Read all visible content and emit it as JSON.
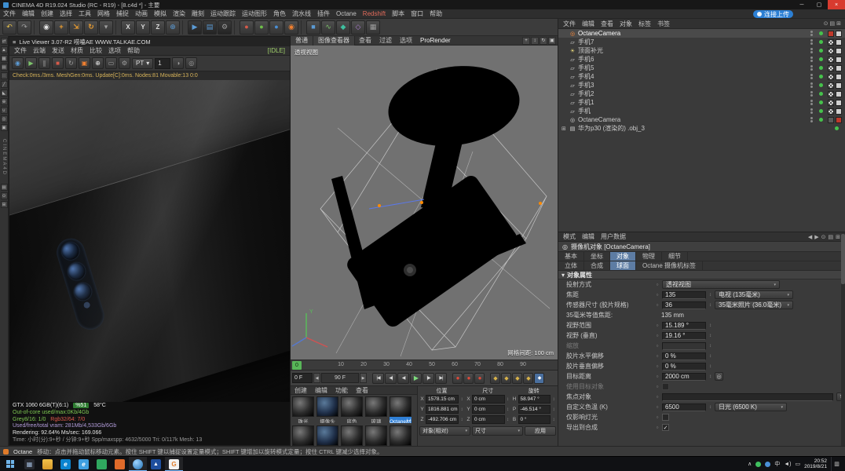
{
  "titlebar": {
    "title": "CINEMA 4D R19.024 Studio (RC - R19) - [8.c4d *] - 主要"
  },
  "window_controls": {
    "minimize": "─",
    "maximize": "▢",
    "close": "×"
  },
  "menubar": {
    "items": [
      "文件",
      "编辑",
      "创建",
      "选择",
      "工具",
      "网格",
      "捕捉",
      "动画",
      "模拟",
      "渲染",
      "雕刻",
      "运动跟踪",
      "运动图形",
      "角色",
      "流水线",
      "插件",
      "Octane",
      "Redshift",
      "脚本",
      "窗口",
      "帮助"
    ],
    "upload_badge": "连接上传"
  },
  "toolbar": {
    "axis_x": "X",
    "axis_y": "Y",
    "axis_z": "Z"
  },
  "left_palette": {
    "vertical_label": "CINEMA4D"
  },
  "icons": {
    "burger": "≡",
    "dot": "○",
    "undo": "↶",
    "redo": "↷",
    "live_selection": "◉",
    "move": "+",
    "scale": "⇲",
    "rotate": "↻",
    "last_tool": "▾",
    "coord": "⊕",
    "render_view": "▶",
    "render_pv": "▤",
    "render_settings": "⚙",
    "plugin_red": "●",
    "plugin_green": "●",
    "plugin_blue": "●",
    "octane": "◉",
    "cube": "■",
    "pen": "∿",
    "mograph": "◆",
    "deformer": "◇",
    "xpresso": "▦",
    "convert": "⇄",
    "model": "▲",
    "texture": "▦",
    "workplane": "▤",
    "points": "∷",
    "edges": "╱",
    "polygons": "◣",
    "axis": "⊕",
    "snap": "∪",
    "solo": "◎",
    "lockpal": "▣",
    "play": "▶",
    "pause": "∥",
    "stop": "■",
    "restart": "↻",
    "lock": "▣",
    "pick": "⊕",
    "region": "▭",
    "gear": "⚙",
    "clay": "◑",
    "dd": "▾",
    "spin": "↕",
    "check": "✓",
    "up": "↑",
    "target": "◎",
    "skip_start": "|◀",
    "prev_key": "◀|",
    "prev": "◀",
    "next": "▶",
    "next_key": "|▶",
    "skip_end": "▶|",
    "record": "●",
    "key": "◆",
    "cam_obj": "◎",
    "mesh_obj": "▱",
    "light_obj": "☀",
    "file_obj": "▤",
    "expander": "⊞",
    "nav_left": "◀",
    "nav_right": "▶",
    "lock2": "⊙",
    "grid2": "▤",
    "plus": "⊞",
    "chevron": "∧",
    "volume": "◄)",
    "battery": "▭",
    "notif": "▥",
    "taskview": "▦",
    "photos": "▲",
    "pan": "+",
    "zoomv": "↕",
    "rotv": "↻",
    "maxv": "▣",
    "viewcam": "◎"
  },
  "live_viewer": {
    "title": "Live Viewer 3.07-R2 唠嗑AE WWW.TALKAE.COM",
    "menus": [
      "文件",
      "云端",
      "发送",
      "材质",
      "比较",
      "选项",
      "帮助"
    ],
    "idle": "[IDLE]",
    "mode": "PT",
    "samples": "1",
    "status_line": "Check:0ms./3ms. MeshGen:0ms. Update[C]:0ms. Nodes:81 Movable:13  0:0",
    "gpu_name": "GTX 1060 6GB(T)(6:1)",
    "gpu_load": "%51",
    "gpu_temp": "58°C",
    "oc_line": "Out-of-core used/max:0Kb/4Gb",
    "grey_line": "Grey8/16: 1/0",
    "rgb_line": "Rgb32/64: 7/0",
    "vram_line": "Used/free/total vram: 281Mb/4,533Gb/6Gb",
    "render_line": "Rendering: 92.64%  Ms/sec: 169.066",
    "time_line": "Time: 小时(分):9+秒 / 分钟:9+秒  Spp/maxspp: 4632/5000  Tri: 0/117k  Mesh: 13"
  },
  "viewport": {
    "tabs": [
      "普通",
      "图像查看器"
    ],
    "menus": [
      "查看",
      "过滤",
      "选项",
      "ProRender"
    ],
    "view_label": "透视视图",
    "grid_label": "网格间距: 100 cm",
    "gizmo_y": "Y"
  },
  "timeline": {
    "playhead": "0",
    "ticks": [
      "10",
      "20",
      "30",
      "40",
      "50",
      "60",
      "70",
      "80",
      "90"
    ],
    "current": "0 F",
    "end": "90 F"
  },
  "materials": {
    "tabs": [
      "创建",
      "编辑",
      "功能",
      "查看"
    ],
    "labels": [
      "珠光",
      "摄像头",
      "底色",
      "玻璃",
      "Octane材质"
    ]
  },
  "coordinates": {
    "headers": [
      "位置",
      "尺寸",
      "旋转"
    ],
    "position": [
      {
        "axis": "X",
        "value": "1578.15 cm"
      },
      {
        "axis": "Y",
        "value": "1816.881 cm"
      },
      {
        "axis": "Z",
        "value": "-492.706 cm"
      }
    ],
    "size": [
      {
        "axis": "X",
        "value": "0 cm"
      },
      {
        "axis": "Y",
        "value": "0 cm"
      },
      {
        "axis": "Z",
        "value": "0 cm"
      }
    ],
    "rotation": [
      {
        "axis": "H",
        "value": "58.947 °"
      },
      {
        "axis": "P",
        "value": "-46.514 °"
      },
      {
        "axis": "B",
        "value": "0 °"
      }
    ],
    "mode_object": "对象(相对)",
    "mode_size": "尺寸",
    "apply": "应用"
  },
  "object_manager": {
    "menus": [
      "文件",
      "编辑",
      "查看",
      "对象",
      "标签",
      "书签"
    ],
    "items": [
      {
        "name": "OctaneCamera"
      },
      {
        "name": "手机7"
      },
      {
        "name": "顶面补光"
      },
      {
        "name": "手机6"
      },
      {
        "name": "手机5"
      },
      {
        "name": "手机4"
      },
      {
        "name": "手机3"
      },
      {
        "name": "手机2"
      },
      {
        "name": "手机1"
      },
      {
        "name": "手机"
      },
      {
        "name": "OctaneCamera"
      },
      {
        "name": "华为p30 (渲染的) .obj_3"
      }
    ]
  },
  "attributes": {
    "menus": [
      "模式",
      "编辑",
      "用户数据"
    ],
    "title": "摄像机对象 [OctaneCamera]",
    "tabs1": [
      "基本",
      "坐标",
      "对象",
      "物理",
      "细节"
    ],
    "tabs2": [
      "立体",
      "合成",
      "球面",
      "Octane 摄像机标签"
    ],
    "section": "对象属性",
    "projection_label": "投射方式",
    "projection_value": "透视视图",
    "focal_label": "焦距",
    "focal_value": "135",
    "focal_preset": "电视 (135毫米)",
    "sensor_label": "传感器尺寸 (胶片规格)",
    "sensor_value": "36",
    "sensor_preset": "35毫米照片 (36.0毫米)",
    "equiv_label": "35毫米等值焦距:",
    "equiv_value": "135 mm",
    "fov_label": "视野范围",
    "fov_value": "15.189 °",
    "fovv_label": "视野 (垂直)",
    "fovv_value": "19.16 °",
    "zoom_label": "缩放",
    "filmx_label": "胶片水平偏移",
    "filmx_value": "0 %",
    "filmy_label": "胶片垂直偏移",
    "filmy_value": "0 %",
    "target_label": "目标距离",
    "target_value": "2000 cm",
    "usetarget_label": "使用目标对象",
    "focus_label": "焦点对象",
    "temp_label": "自定义色温 (K)",
    "temp_value": "6500",
    "temp_preset": "日光 (6500 K)",
    "affect_label": "仅影响灯光",
    "export_label": "导出到合成"
  },
  "statusbar": {
    "app": "Octane",
    "message": "移动：点击并拖动鼠标移动元素。按住 SHIFT 键以捕捉设置定量模式；SHIFT 键增加以旋转模式定量；按住 CTRL 键减少选择对象。"
  },
  "taskbar": {
    "lang": "中",
    "time": "20:52",
    "date": "2019/8/21",
    "edge_label": "e",
    "g_label": "G"
  }
}
